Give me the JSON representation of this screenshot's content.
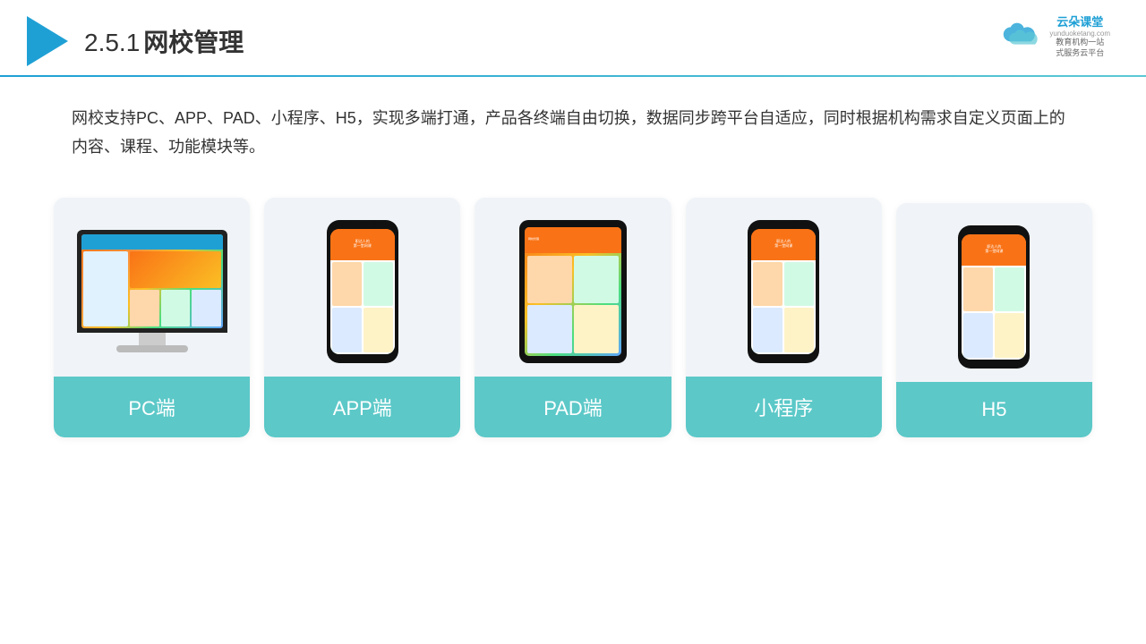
{
  "header": {
    "title": "2.5.1网校管理",
    "title_num": "2.5.1",
    "title_text": "网校管理"
  },
  "brand": {
    "name": "云朵课堂",
    "url": "yunduoketang.com",
    "sub": "教育机构一站\n式服务云平台"
  },
  "description": {
    "text": "网校支持PC、APP、PAD、小程序、H5，实现多端打通，产品各终端自由切换，数据同步跨平台自适应，同时根据机构需求自定义页面上的内容、课程、功能模块等。"
  },
  "cards": [
    {
      "id": "pc",
      "label": "PC端",
      "device": "monitor"
    },
    {
      "id": "app",
      "label": "APP端",
      "device": "phone"
    },
    {
      "id": "pad",
      "label": "PAD端",
      "device": "tablet"
    },
    {
      "id": "miniapp",
      "label": "小程序",
      "device": "phone"
    },
    {
      "id": "h5",
      "label": "H5",
      "device": "phone"
    }
  ]
}
